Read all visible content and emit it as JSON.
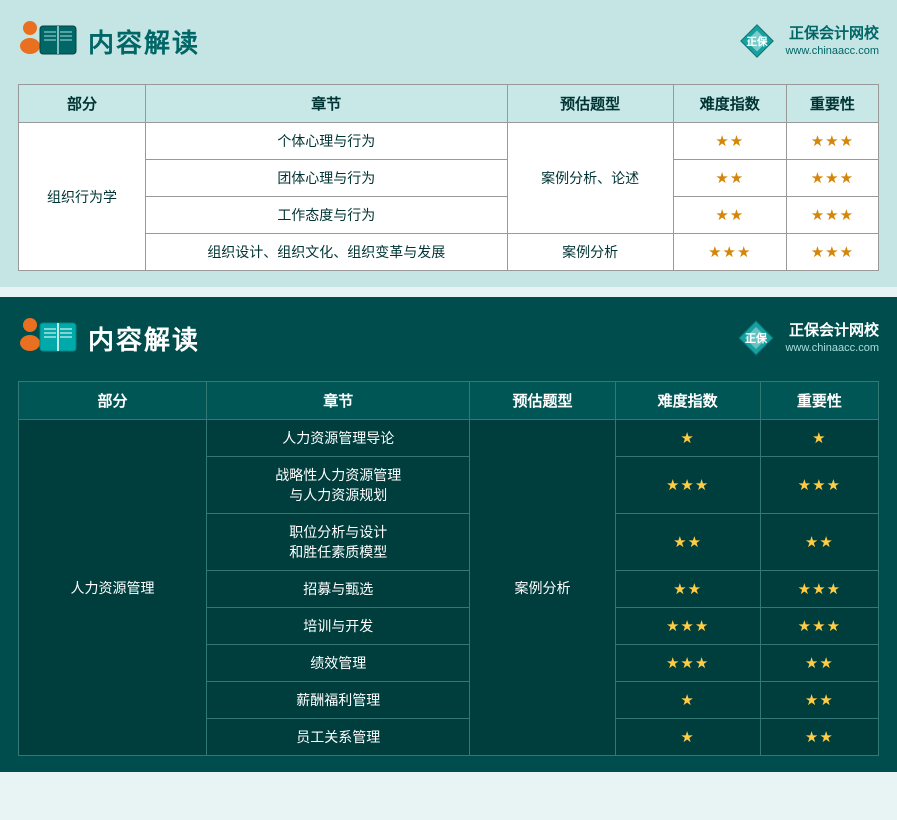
{
  "section1": {
    "title": "内容解读",
    "brand": "正保会计网校",
    "url": "www.chinaacc.com",
    "table": {
      "headers": [
        "部分",
        "章节",
        "预估题型",
        "难度指数",
        "重要性"
      ],
      "rows": [
        {
          "part": "组织行为学",
          "part_rowspan": 4,
          "chapters": [
            {
              "name": "个体心理与行为",
              "type": "案例分析、论述",
              "type_rowspan": 3,
              "difficulty": "★★",
              "importance": "★★★"
            },
            {
              "name": "团体心理与行为",
              "type": null,
              "difficulty": "★★",
              "importance": "★★★"
            },
            {
              "name": "工作态度与行为",
              "type": null,
              "difficulty": "★★",
              "importance": "★★★"
            },
            {
              "name": "组织设计、组织文化、组织变革与发展",
              "type": "案例分析",
              "type_rowspan": 1,
              "difficulty": "★★★",
              "importance": "★★★"
            }
          ]
        }
      ]
    }
  },
  "section2": {
    "title": "内容解读",
    "brand": "正保会计网校",
    "url": "www.chinaacc.com",
    "table": {
      "headers": [
        "部分",
        "章节",
        "预估题型",
        "难度指数",
        "重要性"
      ],
      "rows": [
        {
          "part": "人力资源管理",
          "chapters": [
            {
              "name": "人力资源管理导论",
              "type": "案例分析",
              "type_rowspan": 8,
              "difficulty": "★",
              "importance": "★"
            },
            {
              "name": "战略性人力资源管理与人力资源规划",
              "difficulty": "★★★",
              "importance": "★★★"
            },
            {
              "name": "职位分析与设计和胜任素质模型",
              "difficulty": "★★",
              "importance": "★★"
            },
            {
              "name": "招募与甄选",
              "difficulty": "★★",
              "importance": "★★★"
            },
            {
              "name": "培训与开发",
              "difficulty": "★★★",
              "importance": "★★★"
            },
            {
              "name": "绩效管理",
              "difficulty": "★★★",
              "importance": "★★"
            },
            {
              "name": "薪酬福利管理",
              "difficulty": "★",
              "importance": "★★"
            },
            {
              "name": "员工关系管理",
              "difficulty": "★",
              "importance": "★★"
            }
          ]
        }
      ]
    }
  }
}
